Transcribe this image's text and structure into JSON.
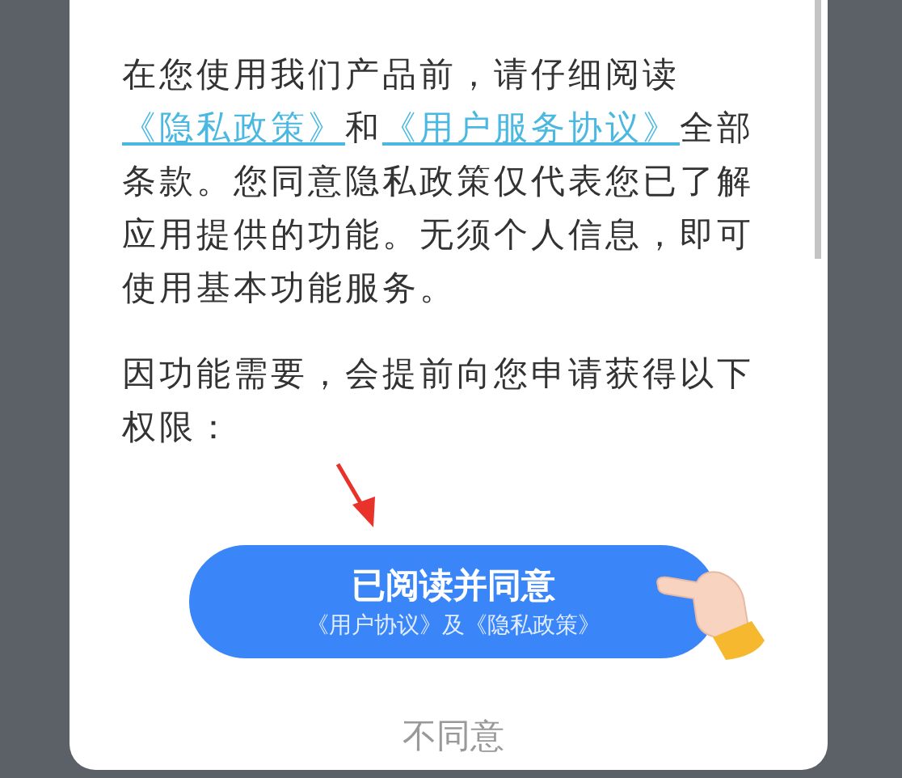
{
  "dialog": {
    "paragraphs": [
      {
        "segments": [
          {
            "kind": "text",
            "text": "在您使用我们产品前，请仔细阅读"
          },
          {
            "kind": "link",
            "text": "《隐私政策》"
          },
          {
            "kind": "text",
            "text": "和"
          },
          {
            "kind": "link",
            "text": "《用户服务协议》"
          },
          {
            "kind": "text",
            "text": "全部条款。您同意隐私政策仅代表您已了解应用提供的功能。无须个人信息，即可使用基本功能服务。"
          }
        ]
      },
      {
        "segments": [
          {
            "kind": "text",
            "text": "因功能需要，会提前向您申请获得以下权限："
          }
        ]
      }
    ],
    "agree_button": {
      "label": "已阅读并同意",
      "sublabel": "《用户协议》及《隐私政策》"
    },
    "decline_button": {
      "label": "不同意"
    }
  }
}
